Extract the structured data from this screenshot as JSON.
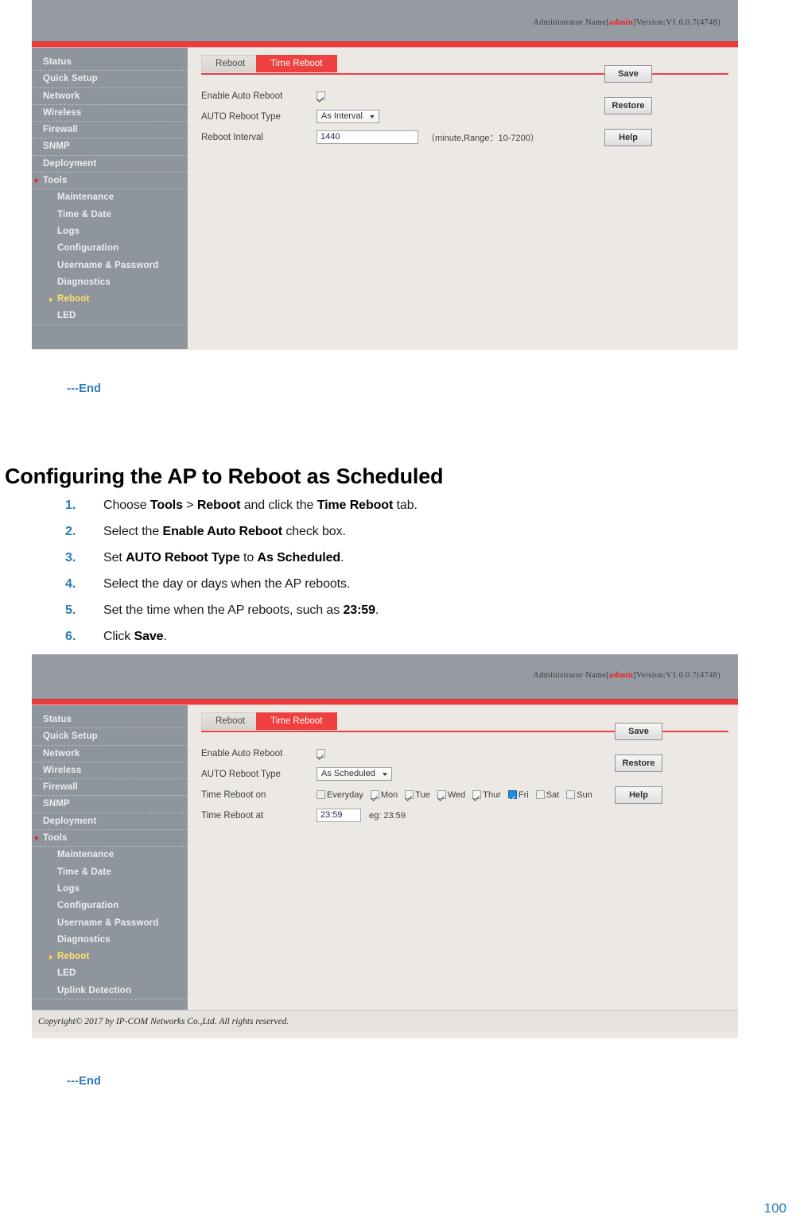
{
  "document": {
    "heading": "Configuring the AP to Reboot as Scheduled",
    "end_marker_1": "---End",
    "end_marker_2": "---End",
    "page_number": "100",
    "steps": [
      {
        "num": "1.",
        "parts": [
          {
            "t": "Choose ",
            "b": false
          },
          {
            "t": "Tools",
            "b": true
          },
          {
            "t": " > ",
            "b": false
          },
          {
            "t": "Reboot",
            "b": true
          },
          {
            "t": " and click the ",
            "b": false
          },
          {
            "t": "Time Reboot",
            "b": true
          },
          {
            "t": " tab.",
            "b": false
          }
        ]
      },
      {
        "num": "2.",
        "parts": [
          {
            "t": "Select the ",
            "b": false
          },
          {
            "t": "Enable Auto Reboot",
            "b": true
          },
          {
            "t": " check box.",
            "b": false
          }
        ]
      },
      {
        "num": "3.",
        "parts": [
          {
            "t": "Set ",
            "b": false
          },
          {
            "t": "AUTO Reboot Type",
            "b": true
          },
          {
            "t": " to ",
            "b": false
          },
          {
            "t": "As Scheduled",
            "b": true
          },
          {
            "t": ".",
            "b": false
          }
        ]
      },
      {
        "num": "4.",
        "parts": [
          {
            "t": "Select the day or days when the AP reboots.",
            "b": false
          }
        ]
      },
      {
        "num": "5.",
        "parts": [
          {
            "t": "Set the time when the AP reboots, such as ",
            "b": false
          },
          {
            "t": "23:59",
            "b": true
          },
          {
            "t": ".",
            "b": false
          }
        ]
      },
      {
        "num": "6.",
        "parts": [
          {
            "t": "Click ",
            "b": false
          },
          {
            "t": "Save",
            "b": true
          },
          {
            "t": ".",
            "b": false
          }
        ]
      }
    ]
  },
  "colors": {
    "brand_red": "#ee4040",
    "header_gray": "#969ba3",
    "sidebar_gray": "#8f959d",
    "panel_beige": "#ece9e4",
    "accent_blue": "#2a7ab9",
    "current_item_yellow": "#ffe26a",
    "focus_blue": "#1f8ae0"
  },
  "screenshot_1": {
    "header": {
      "admin_prefix": "Administrator Name[",
      "admin_user": "admin",
      "admin_suffix": "]Version:V1.0.0.7(4748)"
    },
    "sidebar": {
      "items": [
        {
          "label": "Status",
          "level": "top"
        },
        {
          "label": "Quick Setup",
          "level": "top"
        },
        {
          "label": "Network",
          "level": "top"
        },
        {
          "label": "Wireless",
          "level": "top"
        },
        {
          "label": "Firewall",
          "level": "top"
        },
        {
          "label": "SNMP",
          "level": "top"
        },
        {
          "label": "Deployment",
          "level": "top"
        },
        {
          "label": "Tools",
          "level": "top",
          "state": "expanded"
        },
        {
          "label": "Maintenance",
          "level": "sub"
        },
        {
          "label": "Time & Date",
          "level": "sub"
        },
        {
          "label": "Logs",
          "level": "sub"
        },
        {
          "label": "Configuration",
          "level": "sub"
        },
        {
          "label": "Username & Password",
          "level": "sub"
        },
        {
          "label": "Diagnostics",
          "level": "sub"
        },
        {
          "label": "Reboot",
          "level": "sub",
          "state": "current"
        },
        {
          "label": "LED",
          "level": "sub"
        }
      ]
    },
    "tabs": [
      {
        "label": "Reboot",
        "active": false
      },
      {
        "label": "Time Reboot",
        "active": true
      }
    ],
    "form": {
      "enable_auto_reboot_label": "Enable Auto Reboot",
      "enable_auto_reboot_checked": true,
      "auto_reboot_type_label": "AUTO Reboot Type",
      "auto_reboot_type_value": "As Interval",
      "auto_reboot_type_options": [
        "As Interval",
        "As Scheduled"
      ],
      "reboot_interval_label": "Reboot Interval",
      "reboot_interval_value": "1440",
      "reboot_interval_hint": "（minute,Range：10-7200）"
    },
    "buttons": {
      "save": "Save",
      "restore": "Restore",
      "help": "Help"
    }
  },
  "screenshot_2": {
    "header": {
      "admin_prefix": "Administrator Name[",
      "admin_user": "admin",
      "admin_suffix": "]Version:V1.0.0.7(4748)"
    },
    "sidebar": {
      "items": [
        {
          "label": "Status",
          "level": "top"
        },
        {
          "label": "Quick Setup",
          "level": "top"
        },
        {
          "label": "Network",
          "level": "top"
        },
        {
          "label": "Wireless",
          "level": "top"
        },
        {
          "label": "Firewall",
          "level": "top"
        },
        {
          "label": "SNMP",
          "level": "top"
        },
        {
          "label": "Deployment",
          "level": "top"
        },
        {
          "label": "Tools",
          "level": "top",
          "state": "expanded"
        },
        {
          "label": "Maintenance",
          "level": "sub"
        },
        {
          "label": "Time & Date",
          "level": "sub"
        },
        {
          "label": "Logs",
          "level": "sub"
        },
        {
          "label": "Configuration",
          "level": "sub"
        },
        {
          "label": "Username & Password",
          "level": "sub"
        },
        {
          "label": "Diagnostics",
          "level": "sub"
        },
        {
          "label": "Reboot",
          "level": "sub",
          "state": "current"
        },
        {
          "label": "LED",
          "level": "sub"
        },
        {
          "label": "Uplink Detection",
          "level": "sub"
        }
      ]
    },
    "tabs": [
      {
        "label": "Reboot",
        "active": false
      },
      {
        "label": "Time Reboot",
        "active": true
      }
    ],
    "form": {
      "enable_auto_reboot_label": "Enable Auto Reboot",
      "enable_auto_reboot_checked": true,
      "auto_reboot_type_label": "AUTO Reboot Type",
      "auto_reboot_type_value": "As Scheduled",
      "auto_reboot_type_options": [
        "As Interval",
        "As Scheduled"
      ],
      "time_reboot_on_label": "Time Reboot on",
      "days": [
        {
          "label": "Everyday",
          "checked": false,
          "focused": false
        },
        {
          "label": "Mon",
          "checked": true,
          "focused": false
        },
        {
          "label": "Tue",
          "checked": true,
          "focused": false
        },
        {
          "label": "Wed",
          "checked": true,
          "focused": false
        },
        {
          "label": "Thur",
          "checked": true,
          "focused": false
        },
        {
          "label": "Fri",
          "checked": true,
          "focused": true
        },
        {
          "label": "Sat",
          "checked": false,
          "focused": false
        },
        {
          "label": "Sun",
          "checked": false,
          "focused": false
        }
      ],
      "time_reboot_at_label": "Time Reboot at",
      "time_reboot_at_value": "23:59",
      "time_reboot_at_hint": "eg: 23:59"
    },
    "buttons": {
      "save": "Save",
      "restore": "Restore",
      "help": "Help"
    },
    "footer": "Copyright© 2017 by IP-COM Networks Co.,Ltd. All rights reserved."
  }
}
